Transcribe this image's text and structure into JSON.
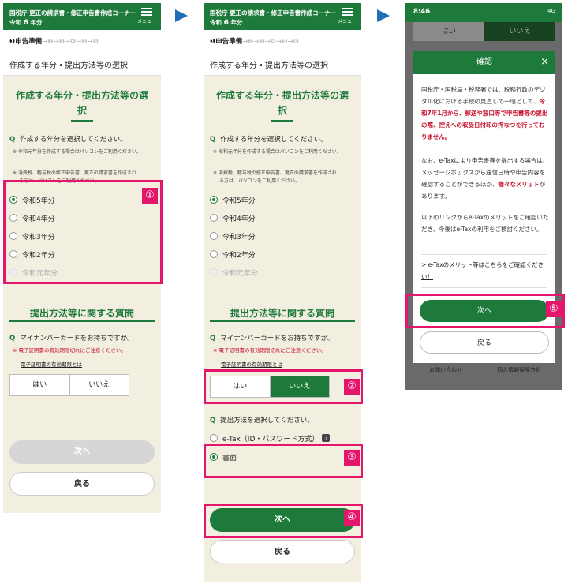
{
  "header": {
    "title": "国税庁 更正の請求書・修正申告書作成コーナー",
    "year_prefix": "令和",
    "year_num": "6",
    "year_suffix": "年分",
    "menu_label": "メニュー"
  },
  "steps": {
    "current": "❶申告準備",
    "rest": "→❷→❸→❹→❺→❻",
    "rest_p2": "→❷→❸→❹→❺→❽"
  },
  "page_title": "作成する年分・提出方法等の選択",
  "section1": {
    "title_line1": "作成する年分・提出方法等の選",
    "title_line2": "択",
    "q_mark": "Q",
    "question": "作成する年分を選択してください。",
    "note1": "※ 令和元年分を作成する場合はパソコンをご利用ください。",
    "note2a": "※ 消費税、贈与税の修正申告書、更正の請求書を作成され",
    "note2b": "る方は、パソコンをご利用ください。",
    "options": [
      "令和5年分",
      "令和4年分",
      "令和3年分",
      "令和2年分",
      "令和元年分"
    ]
  },
  "section2": {
    "title": "提出方法等に関する質問",
    "q_mark": "Q",
    "question": "マイナンバーカードをお持ちですか。",
    "rednote": "※ 電子証明書の有効期限切れにご注意ください。",
    "link": "電子証明書の有効期限とは",
    "yes": "はい",
    "no": "いいえ"
  },
  "section3": {
    "q_mark": "Q",
    "question": "提出方法を選択してください。",
    "etax": "e-Tax（ID・パスワード方式）",
    "help": "?",
    "paper": "書面"
  },
  "buttons": {
    "next": "次へ",
    "back": "戻る"
  },
  "callouts": [
    "①",
    "②",
    "③",
    "④",
    "⑤"
  ],
  "phone3": {
    "time": "8:46",
    "signal": "4G",
    "bg_yes": "はい",
    "bg_no": "いいえ",
    "modal_title": "確認",
    "close": "×",
    "p1a": "国税庁・国税局・税務署では、税務行政のデジタル化における手続の見直しの一環として、",
    "p1b": "令和7年1月から、郵送や窓口等で申告書等の提出の際、控えへの収受日付印の押なつを行っておりません。",
    "p2a": "なお、e-Taxにより申告書等を提出する場合は、メッセージボックスから送信日時や申告内容を確認することができるほか、",
    "p2b": "様々なメリット",
    "p2c": "があります。",
    "p3": "以下のリンクからe-Taxのメリットをご確認いただき、今後はe-Taxの利用をご検討ください。",
    "link": "e-Taxのメリット等はこちらをご確認ください！",
    "footer_left": "お問い合わせ",
    "footer_right": "個人情報保護方針"
  },
  "colors": {
    "brand_green": "#1d7a3a",
    "accent_pink": "#e4166b",
    "arrow_blue": "#1f6fb5",
    "panel_bg": "#f2efe1"
  }
}
